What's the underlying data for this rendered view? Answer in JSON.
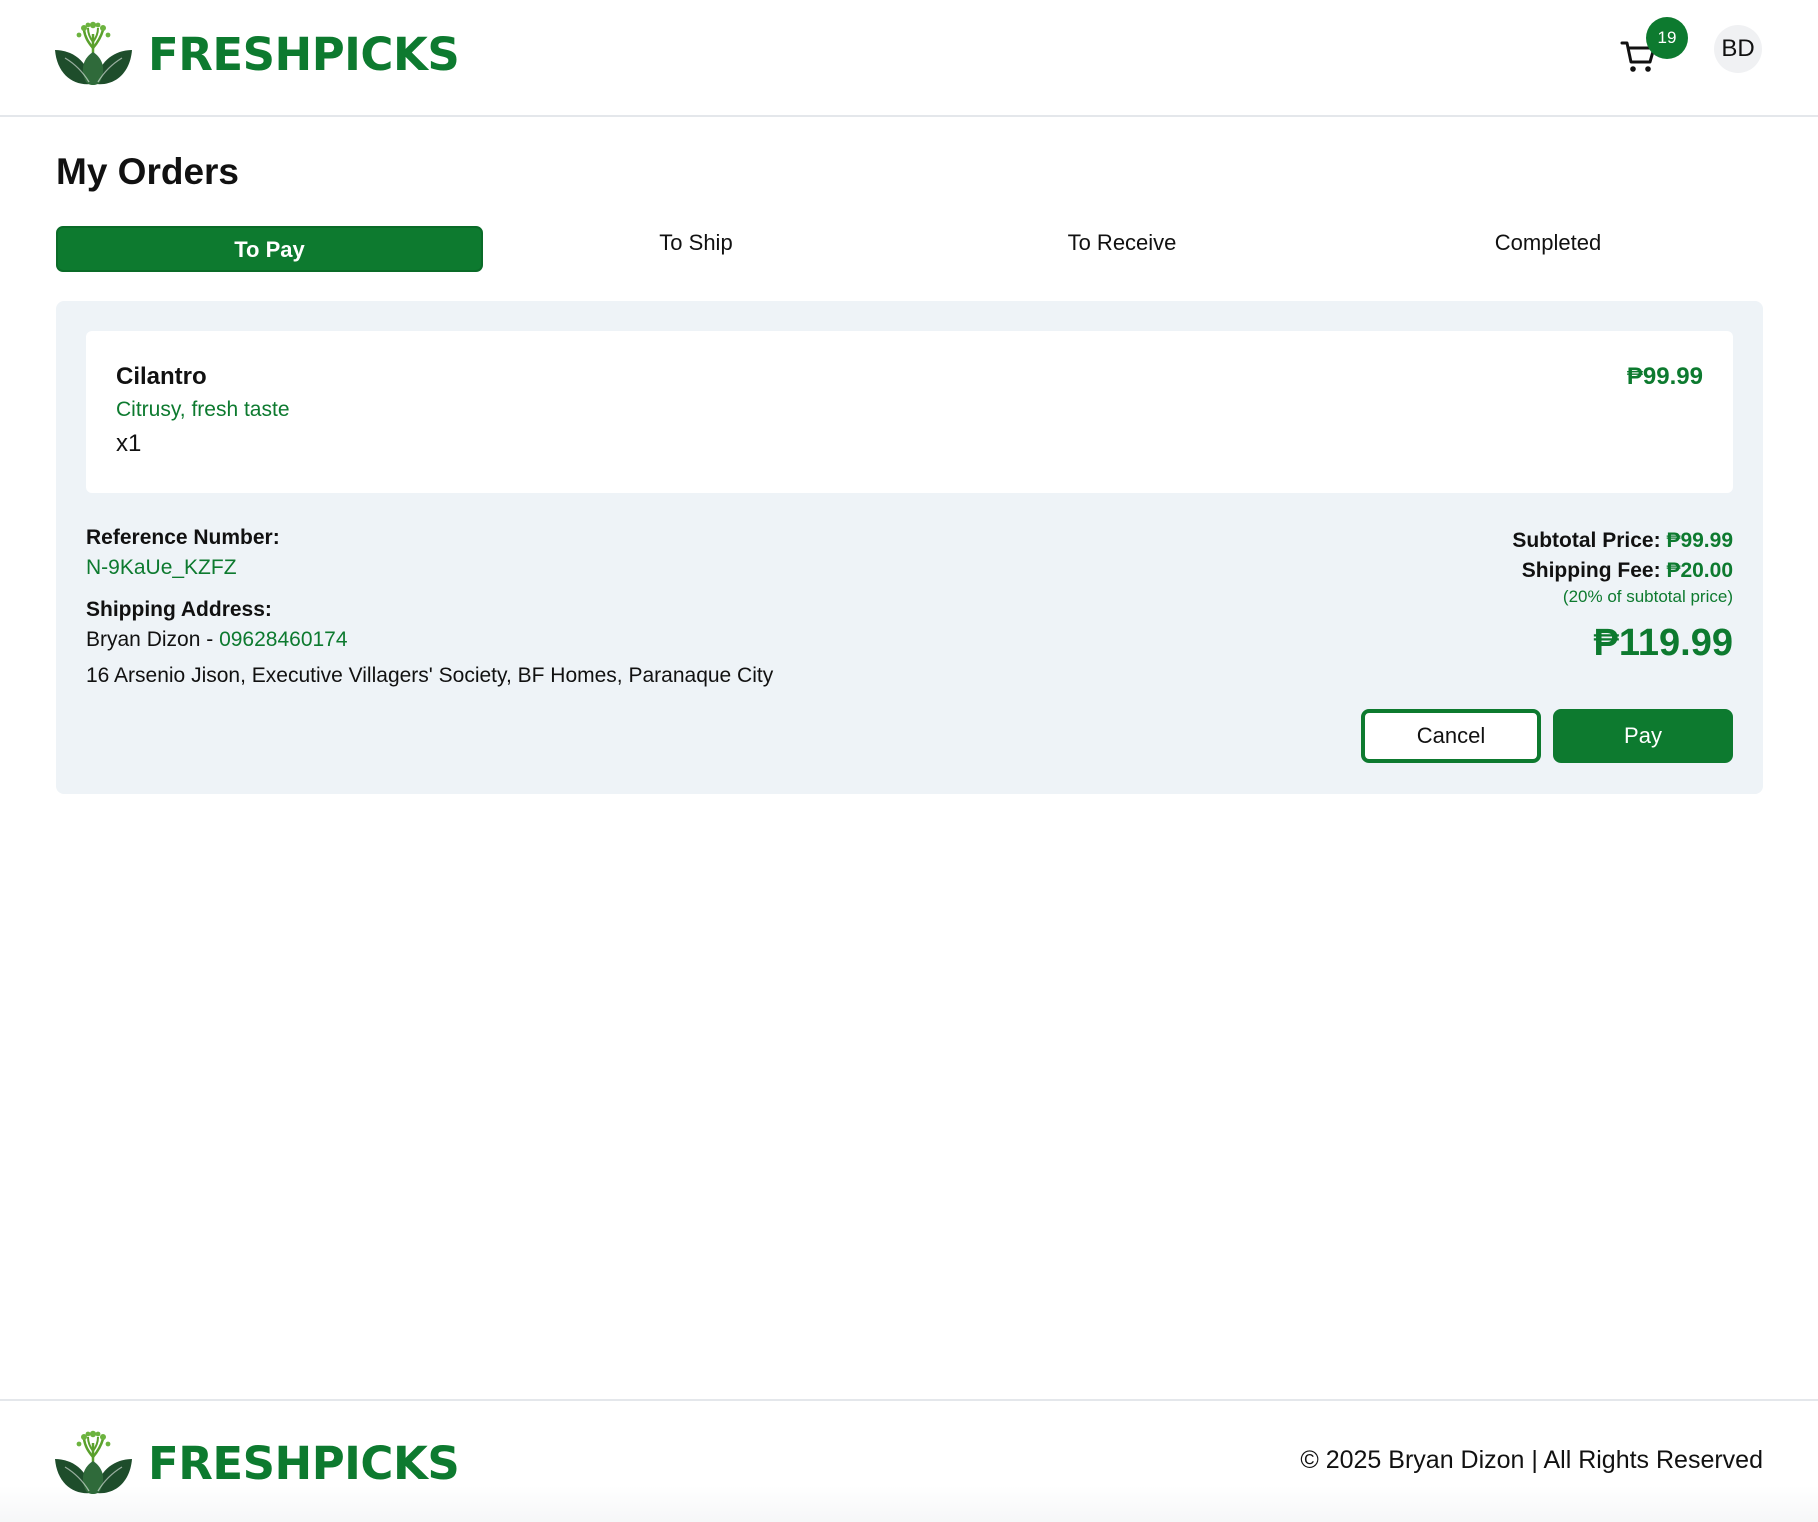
{
  "brand": {
    "name": "FRESHPICKS",
    "logo_icon": "sprout-leaves-logo-icon",
    "color": "#0d7a2f"
  },
  "header": {
    "cart_icon": "shopping-cart-icon",
    "cart_count": "19",
    "avatar_initials": "BD"
  },
  "page": {
    "title": "My Orders"
  },
  "tabs": [
    {
      "label": "To Pay",
      "active": true
    },
    {
      "label": "To Ship",
      "active": false
    },
    {
      "label": "To Receive",
      "active": false
    },
    {
      "label": "Completed",
      "active": false
    }
  ],
  "order": {
    "item": {
      "name": "Cilantro",
      "description": "Citrusy, fresh taste",
      "quantity": "x1",
      "price": "₱99.99"
    },
    "reference_label": "Reference Number:",
    "reference_number": "N-9KaUe_KZFZ",
    "shipping_label": "Shipping Address:",
    "recipient_name": "Bryan Dizon",
    "separator": " - ",
    "recipient_phone": "09628460174",
    "address": "16 Arsenio Jison, Executive Villagers' Society, BF Homes, Paranaque City",
    "subtotal_label": "Subtotal Price:",
    "subtotal_value": "₱99.99",
    "shipping_fee_label": "Shipping Fee:",
    "shipping_fee_value": "₱20.00",
    "shipping_fee_note": "(20% of subtotal price)",
    "total": "₱119.99",
    "cancel_label": "Cancel",
    "pay_label": "Pay"
  },
  "footer": {
    "copyright": "© 2025 Bryan Dizon | All Rights Reserved"
  },
  "colors": {
    "accent": "#0d7a2f",
    "card_background": "#eef3f7"
  }
}
